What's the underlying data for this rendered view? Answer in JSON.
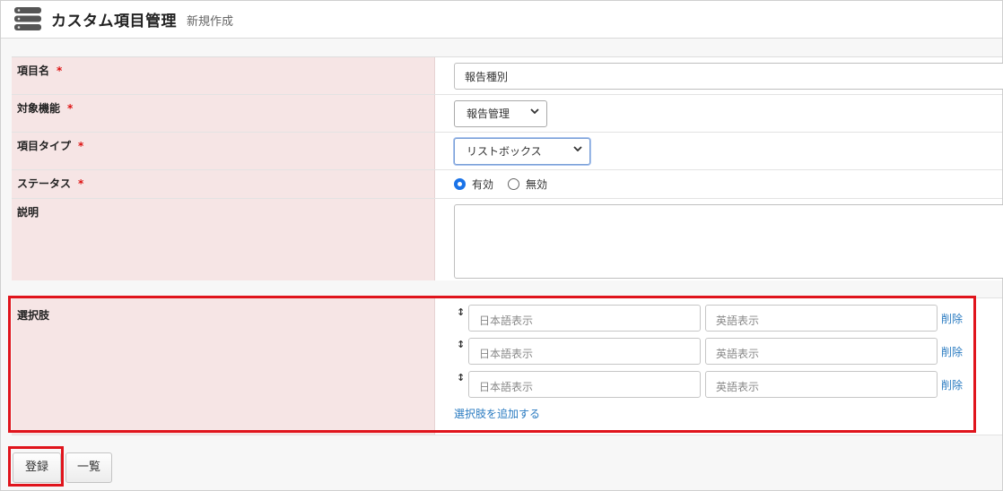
{
  "header": {
    "title": "カスタム項目管理",
    "subtitle": "新規作成",
    "icon": "database-icon"
  },
  "form": {
    "required_mark": "*",
    "fields": [
      {
        "label": "項目名",
        "required": true,
        "value": "報告種別"
      },
      {
        "label": "対象機能",
        "required": true,
        "selected": "報告管理"
      },
      {
        "label": "項目タイプ",
        "required": true,
        "selected": "リストボックス"
      },
      {
        "label": "ステータス",
        "required": true,
        "options": [
          "有効",
          "無効"
        ],
        "checked": "有効"
      },
      {
        "label": "説明",
        "required": false,
        "value": ""
      }
    ]
  },
  "choices": {
    "label": "選択肢",
    "handle_glyph": "↕",
    "rows": [
      {
        "ja_placeholder": "日本語表示",
        "en_placeholder": "英語表示",
        "delete_label": "削除"
      },
      {
        "ja_placeholder": "日本語表示",
        "en_placeholder": "英語表示",
        "delete_label": "削除"
      },
      {
        "ja_placeholder": "日本語表示",
        "en_placeholder": "英語表示",
        "delete_label": "削除"
      }
    ],
    "add_label": "選択肢を追加する"
  },
  "buttons": {
    "register": "登録",
    "list": "一覧"
  },
  "colors": {
    "label_bg": "#f6e5e5",
    "required": "#dd1111",
    "link": "#2a7bc1",
    "highlight": "#e0141c",
    "radio_checked": "#1a73e8"
  }
}
